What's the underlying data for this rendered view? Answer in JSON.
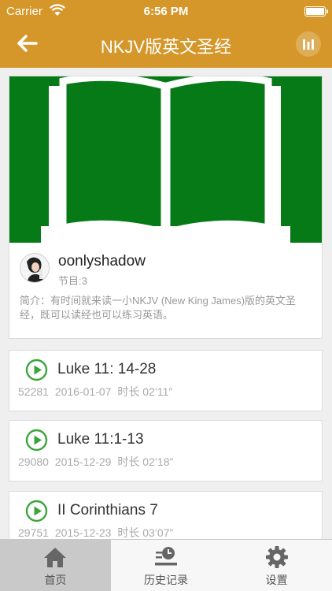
{
  "status_bar": {
    "carrier": "Carrier",
    "time": "6:56 PM"
  },
  "nav": {
    "title": "NKJV版英文圣经"
  },
  "album": {
    "author": "oonlyshadow",
    "episode_count": "节目:3",
    "description": "简介：有时间就来读一小NKJV (New King James)版的英文圣经，既可以读经也可以练习英语。"
  },
  "episodes": [
    {
      "title": "Luke 11: 14-28",
      "plays": "52281",
      "date": "2016-01-07",
      "duration": "时长 02’11”"
    },
    {
      "title": "Luke 11:1-13",
      "plays": "29080",
      "date": "2015-12-29",
      "duration": "时长 02’18”"
    },
    {
      "title": "II Corinthians 7",
      "plays": "29751",
      "date": "2015-12-23",
      "duration": "时长 03’07”"
    }
  ],
  "tabs": [
    {
      "label": "首页",
      "icon": "home-icon",
      "active": true
    },
    {
      "label": "历史记录",
      "icon": "history-icon",
      "active": false
    },
    {
      "label": "设置",
      "icon": "settings-gear-icon",
      "active": false
    }
  ],
  "colors": {
    "header": "#d5972a",
    "cover": "#067a16",
    "play": "#3aa53a"
  }
}
